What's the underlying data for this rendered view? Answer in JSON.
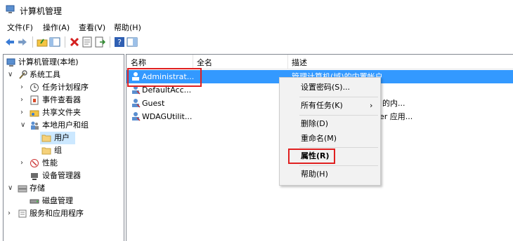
{
  "window": {
    "title": "计算机管理"
  },
  "menu": [
    "文件(F)",
    "操作(A)",
    "查看(V)",
    "帮助(H)"
  ],
  "toolbar": [
    "back-icon",
    "forward-icon",
    "up-icon",
    "show-hide-tree-icon",
    "delete-icon",
    "properties-icon",
    "export-icon",
    "help-icon",
    "show-pane-icon"
  ],
  "tree": {
    "root": "计算机管理(本地)",
    "system_tools": "系统工具",
    "task_scheduler": "任务计划程序",
    "event_viewer": "事件查看器",
    "shared_folders": "共享文件夹",
    "local_users_groups": "本地用户和组",
    "users": "用户",
    "groups": "组",
    "performance": "性能",
    "device_manager": "设备管理器",
    "storage": "存储",
    "disk_management": "磁盘管理",
    "services_apps": "服务和应用程序"
  },
  "list": {
    "columns": [
      "名称",
      "全名",
      "描述"
    ],
    "rows": [
      {
        "name": "Administrat...",
        "fullname": "",
        "desc": "管理计算机(域)的内置帐户"
      },
      {
        "name": "DefaultAcc...",
        "fullname": "",
        "desc": ""
      },
      {
        "name": "Guest",
        "fullname": "",
        "desc": "的内..."
      },
      {
        "name": "WDAGUtilit...",
        "fullname": "",
        "desc": "er 应用..."
      }
    ]
  },
  "context_menu": {
    "set_password": "设置密码(S)...",
    "all_tasks": "所有任务(K)",
    "submenu_arrow": "›",
    "delete": "删除(D)",
    "rename": "重命名(M)",
    "properties": "属性(R)",
    "help": "帮助(H)"
  },
  "colors": {
    "selection": "#3399ff",
    "highlight_box": "#e02020"
  }
}
